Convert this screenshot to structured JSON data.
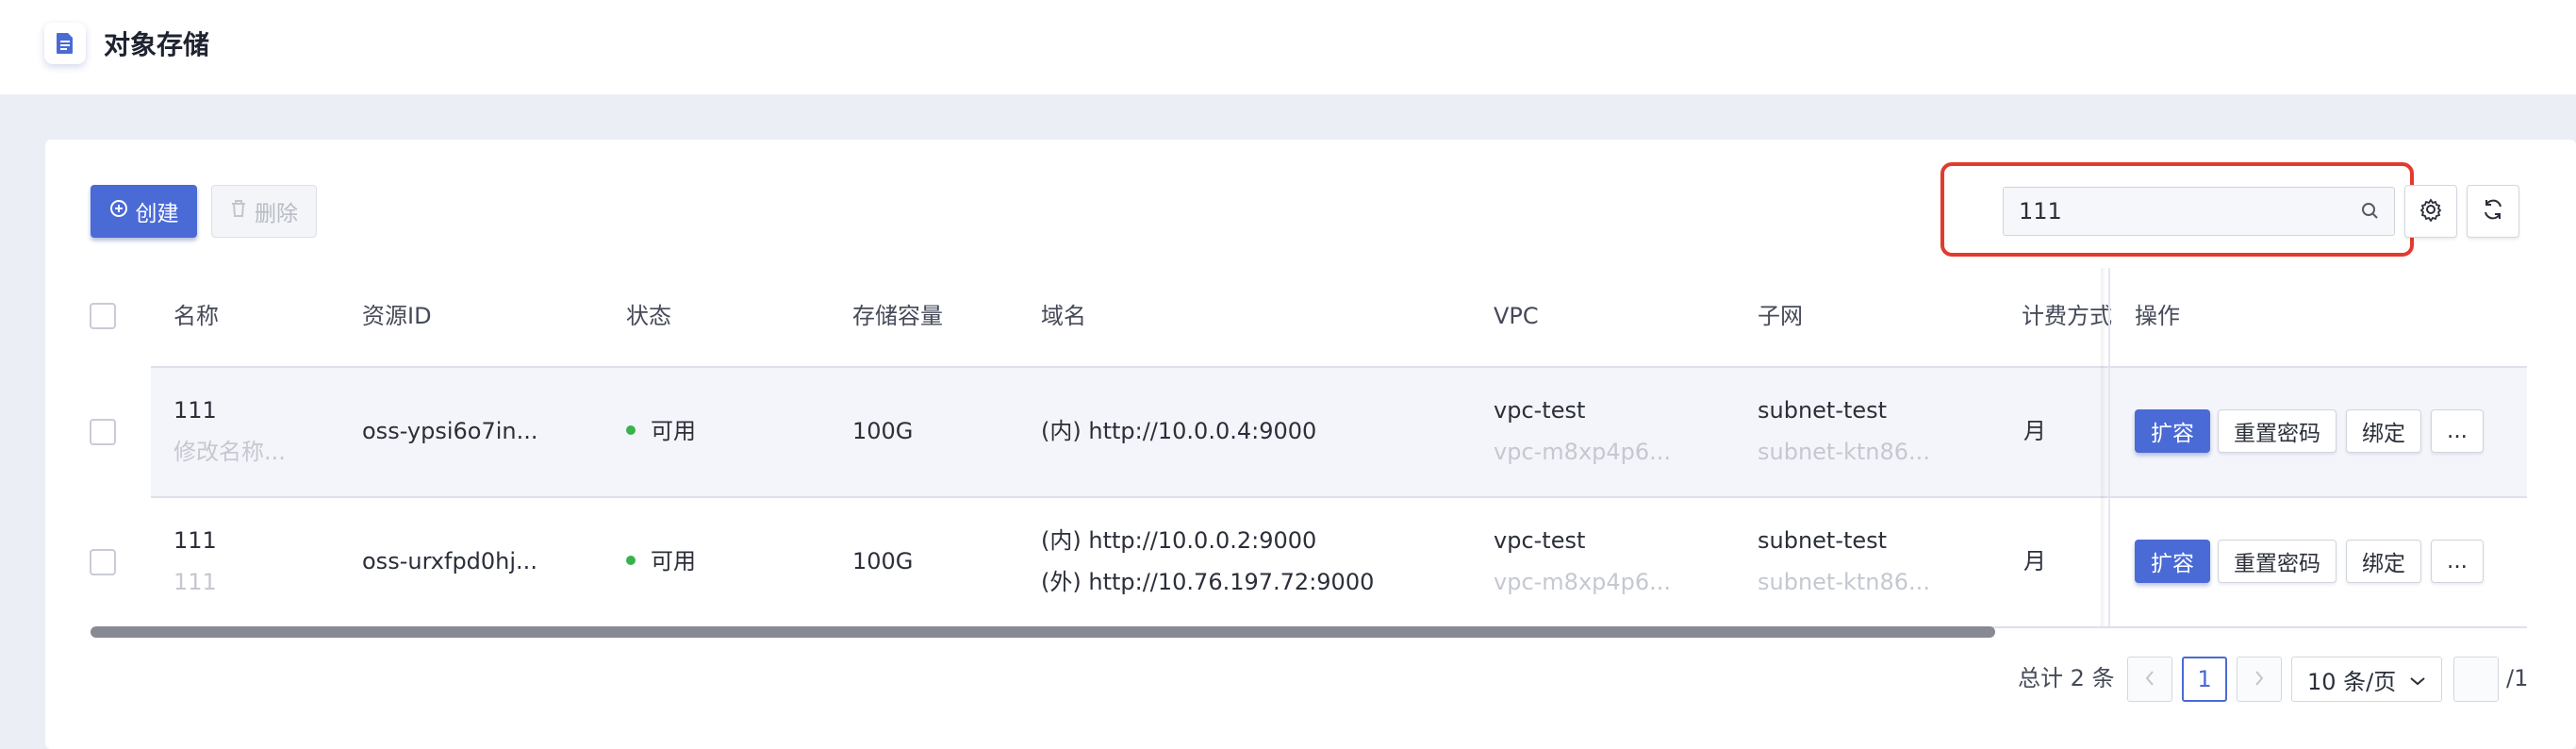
{
  "header": {
    "title": "对象存储",
    "icon": "document-icon"
  },
  "toolbar": {
    "create_label": "创建",
    "delete_label": "删除",
    "search_value": "111",
    "settings_icon": "gear-icon",
    "refresh_icon": "refresh-icon"
  },
  "table": {
    "columns": [
      "名称",
      "资源ID",
      "状态",
      "存储容量",
      "域名",
      "VPC",
      "子网",
      "计费方式",
      "操作"
    ],
    "rows": [
      {
        "name": "111",
        "name_sub": "修改名称...",
        "resource_id": "oss-ypsi6o7in...",
        "status": "可用",
        "capacity": "100G",
        "domain1": "(内) http://10.0.0.4:9000",
        "domain2": "",
        "vpc": "vpc-test",
        "vpc_sub": "vpc-m8xp4p6...",
        "subnet": "subnet-test",
        "subnet_sub": "subnet-ktn86...",
        "billing": "月",
        "actions": [
          "扩容",
          "重置密码",
          "绑定",
          "..."
        ]
      },
      {
        "name": "111",
        "name_sub": "111",
        "resource_id": "oss-urxfpd0hj...",
        "status": "可用",
        "capacity": "100G",
        "domain1": "(内) http://10.0.0.2:9000",
        "domain2": "(外) http://10.76.197.72:9000",
        "vpc": "vpc-test",
        "vpc_sub": "vpc-m8xp4p6...",
        "subnet": "subnet-test",
        "subnet_sub": "subnet-ktn86...",
        "billing": "月",
        "actions": [
          "扩容",
          "重置密码",
          "绑定",
          "..."
        ]
      }
    ]
  },
  "pagination": {
    "total_label": "总计 2 条",
    "current_page": "1",
    "page_size": "10 条/页",
    "of_pages": "/1"
  },
  "colors": {
    "primary": "#4a6ad6",
    "status_ok": "#38b24a",
    "highlight": "#e23b2e"
  }
}
